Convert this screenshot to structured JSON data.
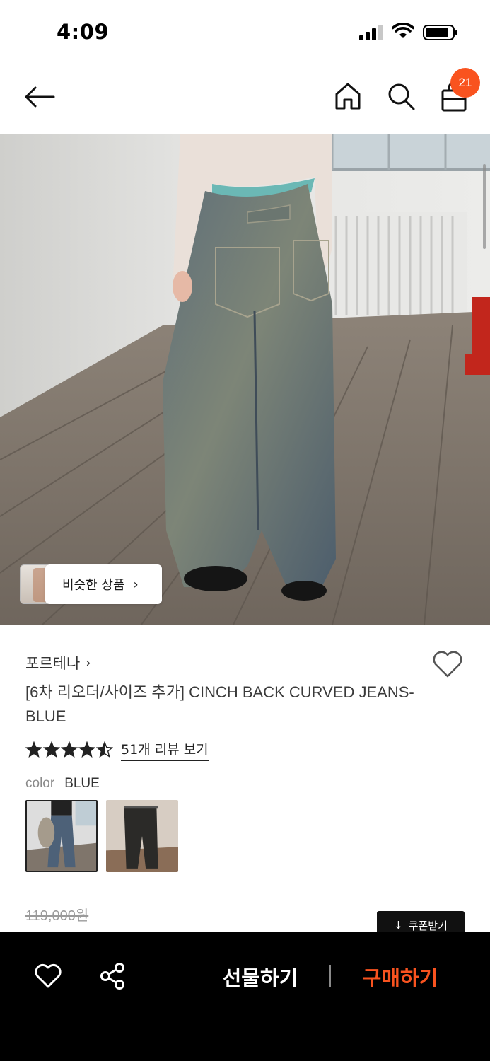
{
  "status_bar": {
    "time": "4:09"
  },
  "header": {
    "cart_count": "21"
  },
  "hero": {
    "similar_products_label": "비슷한 상품"
  },
  "product": {
    "brand": "포르테나",
    "title": "[6차 리오더/사이즈 추가] CINCH BACK CURVED JEANS-BLUE",
    "rating": 4.5,
    "review_link": "51개 리뷰 보기",
    "color_label": "color",
    "color_value": "BLUE",
    "original_price": "119,000원",
    "coupon_label": "쿠폰받기"
  },
  "bottom_bar": {
    "gift_label": "선물하기",
    "buy_label": "구매하기"
  },
  "colors": {
    "accent": "#f9531f",
    "bottom_bar_bg": "#000000"
  }
}
